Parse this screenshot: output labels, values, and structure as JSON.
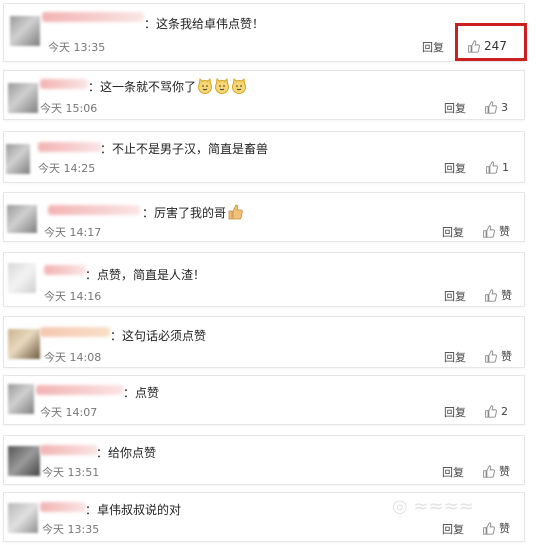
{
  "comments": [
    {
      "text": "：这条我给卓伟点赞！",
      "time": "今天 13:35",
      "reply": "回复",
      "likes": "247"
    },
    {
      "text": "：这一条就不骂你了",
      "time": "今天 15:06",
      "reply": "回复",
      "likes": "3"
    },
    {
      "text": "：不止不是男子汉，简直是畜兽",
      "time": "今天 14:25",
      "reply": "回复",
      "likes": "1"
    },
    {
      "text": "：厉害了我的哥",
      "time": "今天 14:17",
      "reply": "回复",
      "likes": "赞"
    },
    {
      "text": "：点赞，简直是人渣！",
      "time": "今天 14:16",
      "reply": "回复",
      "likes": "赞"
    },
    {
      "text": "：这句话必须点赞",
      "time": "今天 14:08",
      "reply": "回复",
      "likes": "赞"
    },
    {
      "text": "：点赞",
      "time": "今天 14:07",
      "reply": "回复",
      "likes": "2"
    },
    {
      "text": "：给你点赞",
      "time": "今天 13:51",
      "reply": "回复",
      "likes": "赞"
    },
    {
      "text": "：卓伟叔叔说的对",
      "time": "今天 13:35",
      "reply": "回复",
      "likes": "赞"
    }
  ],
  "colors": {
    "highlight": "#cc1f1f",
    "like_icon": "#888888"
  },
  "icons": {
    "like": "thumbs-up-icon",
    "emoji": "cat-face-emoji",
    "thumb_emoji": "thumbs-up-emoji"
  }
}
